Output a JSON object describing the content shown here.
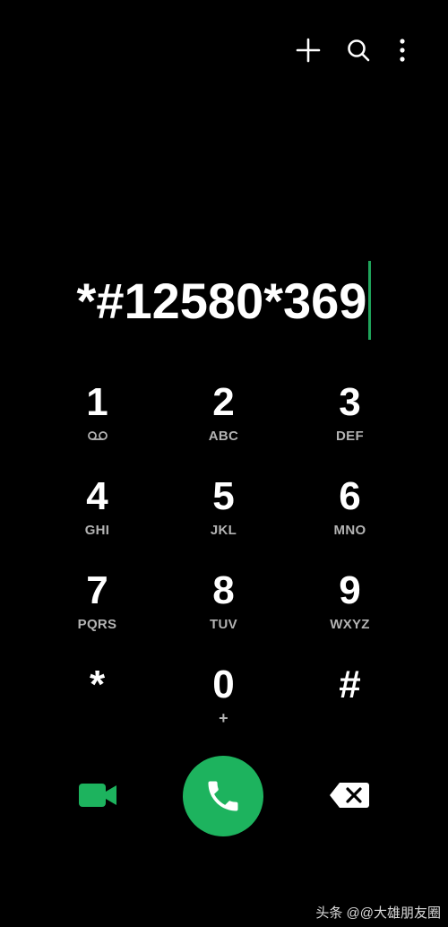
{
  "dialer": {
    "number": "*#12580*369",
    "accent_color": "#1db35e",
    "keys": [
      {
        "digit": "1",
        "sub": "",
        "sub_icon": "voicemail-icon"
      },
      {
        "digit": "2",
        "sub": "ABC"
      },
      {
        "digit": "3",
        "sub": "DEF"
      },
      {
        "digit": "4",
        "sub": "GHI"
      },
      {
        "digit": "5",
        "sub": "JKL"
      },
      {
        "digit": "6",
        "sub": "MNO"
      },
      {
        "digit": "7",
        "sub": "PQRS"
      },
      {
        "digit": "8",
        "sub": "TUV"
      },
      {
        "digit": "9",
        "sub": "WXYZ"
      },
      {
        "digit": "*",
        "sub": ""
      },
      {
        "digit": "0",
        "sub": "+"
      },
      {
        "digit": "#",
        "sub": ""
      }
    ]
  },
  "topbar": {
    "icons": [
      "add-icon",
      "search-icon",
      "more-icon"
    ]
  },
  "bottom": {
    "icons": [
      "video-call-icon",
      "phone-icon",
      "backspace-icon"
    ]
  },
  "watermark": "头条 @@大雄朋友圈"
}
